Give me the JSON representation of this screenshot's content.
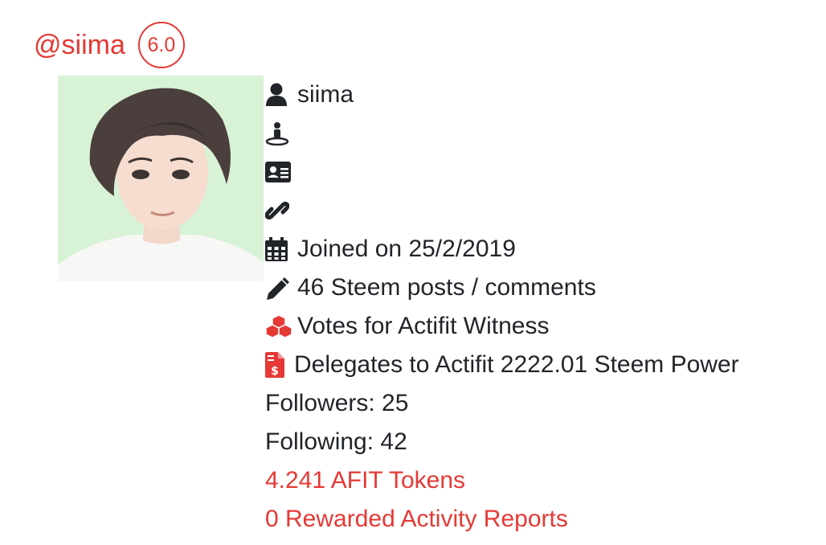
{
  "profile": {
    "handle": "@siima",
    "reputation": "6.0",
    "name": "siima",
    "joined": "Joined on 25/2/2019",
    "posts": "46 Steem posts / comments",
    "witness_vote": "Votes for Actifit Witness",
    "delegation": "Delegates to Actifit 2222.01 Steem Power",
    "followers": "Followers: 25",
    "following": "Following: 42",
    "afit_tokens": "4.241 AFIT Tokens",
    "rewarded_reports": "0 Rewarded Activity Reports"
  },
  "colors": {
    "accent": "#e53935",
    "text": "#212529",
    "avatar_bg": "#d8f2d6"
  },
  "icons": [
    "user-icon",
    "location-icon",
    "id-card-icon",
    "link-icon",
    "calendar-icon",
    "pencil-icon",
    "cubes-icon",
    "file-invoice-dollar-icon"
  ]
}
